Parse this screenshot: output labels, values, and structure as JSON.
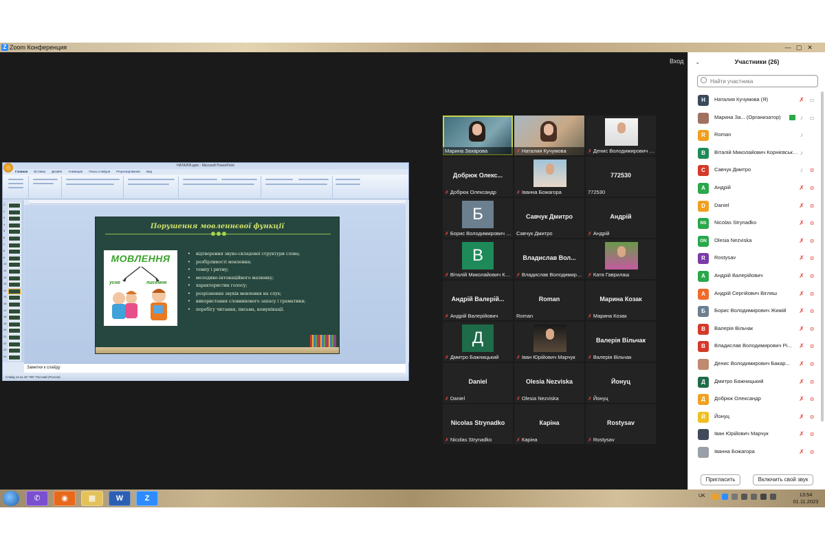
{
  "window": {
    "title": "Zoom Конференция",
    "controls": [
      "—",
      "▢",
      "✕"
    ]
  },
  "meeting": {
    "view_label": "Вход"
  },
  "ppt": {
    "title": "НАТАЛІЯ.pptx - Microsoft PowerPoint",
    "tabs": [
      "Главная",
      "Вставка",
      "Дизайн",
      "Анимация",
      "Показ слайдов",
      "Рецензирование",
      "Вид"
    ],
    "notes_placeholder": "Заметки к слайду",
    "status": "Слайд 14 из 40    \"ОЕ\"    Русский (Россия)",
    "thumb_numbers": [
      "1",
      "2",
      "3",
      "4",
      "5",
      "6",
      "7",
      "8",
      "9",
      "10",
      "11",
      "12",
      "13",
      "14",
      "15",
      "16",
      "17",
      "18",
      "19",
      "20",
      "21",
      "22",
      "23",
      "24"
    ]
  },
  "slide": {
    "title": "Порушення мовленнєвої функції",
    "image_word": "МОВЛЕННЯ",
    "image_left": "усне",
    "image_right": "писемне",
    "bullets": [
      "відтворення звуко-складової структури слова;",
      "розбірливості мовлення;",
      "темпу і ритму;",
      "мелодико-інтонаційного малюнку;",
      " характеристик голосу;",
      "розрізнення звуків мовлення на слух;",
      "використання словникового запасу і граматики;",
      "перебігу читання, письма, комунікації."
    ]
  },
  "grid": {
    "tiles": [
      {
        "name": "",
        "label": "Марина Захарова",
        "muted": false,
        "kind": "video",
        "active": true
      },
      {
        "name": "",
        "label": "Наталия Кучумова",
        "muted": true,
        "kind": "video"
      },
      {
        "name": "",
        "label": "Денис Володимирович Бакар...",
        "muted": true,
        "kind": "photo"
      },
      {
        "name": "Добрюк Олекс...",
        "label": "Добрюк Олександр",
        "muted": true,
        "kind": "name"
      },
      {
        "name": "",
        "label": "Іванна Божагора",
        "muted": true,
        "kind": "photo"
      },
      {
        "name": "772530",
        "label": "772530",
        "muted": false,
        "kind": "name"
      },
      {
        "name": "Б",
        "label": "Борис Володимирович Жижій",
        "muted": true,
        "kind": "letter",
        "color": "#6b7f8f"
      },
      {
        "name": "Савчук Дмитро",
        "label": "Савчук Дмитро",
        "muted": false,
        "kind": "name"
      },
      {
        "name": "Андрій",
        "label": "Андрій",
        "muted": true,
        "kind": "name"
      },
      {
        "name": "В",
        "label": "Віталій Миколайович Корнієвський",
        "muted": true,
        "kind": "letter",
        "color": "#1e8a5a"
      },
      {
        "name": "Владислав Вол...",
        "label": "Владислав Володимирович Рі...",
        "muted": true,
        "kind": "name"
      },
      {
        "name": "",
        "label": "Катя Гаврилаш",
        "muted": true,
        "kind": "photo"
      },
      {
        "name": "Андрій Валерій...",
        "label": "Андрій Валерійович",
        "muted": true,
        "kind": "name"
      },
      {
        "name": "Roman",
        "label": "Roman",
        "muted": false,
        "kind": "name"
      },
      {
        "name": "Марина Козак",
        "label": "Марина Козак",
        "muted": true,
        "kind": "name"
      },
      {
        "name": "Д",
        "label": "Дмитро Бажницький",
        "muted": true,
        "kind": "letter",
        "color": "#1e6b4a"
      },
      {
        "name": "",
        "label": "Іван Юрійович Марчук",
        "muted": true,
        "kind": "photo"
      },
      {
        "name": "Валерія Вільчак",
        "label": "Валерія Вільчак",
        "muted": true,
        "kind": "name"
      },
      {
        "name": "Daniel",
        "label": "Daniel",
        "muted": true,
        "kind": "name"
      },
      {
        "name": "Olesia Nezviska",
        "label": "Olesia Nezviska",
        "muted": true,
        "kind": "name"
      },
      {
        "name": "Йонуц",
        "label": "Йонуц",
        "muted": true,
        "kind": "name"
      },
      {
        "name": "Nicolas Strynadko",
        "label": "Nicolas Strynadko",
        "muted": true,
        "kind": "name"
      },
      {
        "name": "Каріна",
        "label": "Каріна",
        "muted": true,
        "kind": "name"
      },
      {
        "name": "Rostysav",
        "label": "Rostysav",
        "muted": true,
        "kind": "name"
      }
    ]
  },
  "panel": {
    "title": "Участники (26)",
    "search_placeholder": "Найти участника",
    "invite_label": "Пригласить",
    "unmute_label": "Включить свой звук",
    "participants": [
      {
        "initial": "Н",
        "name": "Наталия Кучумова (Я)",
        "color": "#3b4a5a",
        "mic": "muted",
        "cam": "off-gray"
      },
      {
        "initial": "",
        "name": "Марина За... (Организатор)",
        "color": "#a07060",
        "mic": "on",
        "cam": "on"
      },
      {
        "initial": "R",
        "name": "Roman",
        "color": "#f0a020",
        "mic": "on",
        "cam": "none"
      },
      {
        "initial": "В",
        "name": "Віталій Миколайович Корнієвський",
        "color": "#1e8a5a",
        "mic": "on",
        "cam": "none"
      },
      {
        "initial": "С",
        "name": "Савчук Дмитро",
        "color": "#d43a2a",
        "mic": "on",
        "cam": "muted"
      },
      {
        "initial": "А",
        "name": "Андрій",
        "color": "#2aa84a",
        "mic": "muted",
        "cam": "muted"
      },
      {
        "initial": "D",
        "name": "Daniel",
        "color": "#f0a020",
        "mic": "muted",
        "cam": "muted"
      },
      {
        "initial": "NS",
        "name": "Nicolas Strynadko",
        "color": "#2aa84a",
        "mic": "muted",
        "cam": "muted"
      },
      {
        "initial": "ON",
        "name": "Olesia Nezviska",
        "color": "#2aa84a",
        "mic": "muted",
        "cam": "muted"
      },
      {
        "initial": "R",
        "name": "Rostysav",
        "color": "#7a3aa8",
        "mic": "muted",
        "cam": "muted"
      },
      {
        "initial": "А",
        "name": "Андрій Валерійович",
        "color": "#2aa84a",
        "mic": "muted",
        "cam": "muted"
      },
      {
        "initial": "А",
        "name": "Андрій Сергійович Вігляш",
        "color": "#f06a2a",
        "mic": "muted",
        "cam": "muted"
      },
      {
        "initial": "Б",
        "name": "Борис Володимирович Жижій",
        "color": "#6b7f8f",
        "mic": "muted",
        "cam": "muted"
      },
      {
        "initial": "В",
        "name": "Валерія Вільчак",
        "color": "#d43a2a",
        "mic": "muted",
        "cam": "muted"
      },
      {
        "initial": "В",
        "name": "Владислав Володимирович Рі...",
        "color": "#d43a2a",
        "mic": "muted",
        "cam": "muted"
      },
      {
        "initial": "",
        "name": "Денис Володимирович Бакар...",
        "color": "#c08a70",
        "mic": "muted",
        "cam": "muted"
      },
      {
        "initial": "Д",
        "name": "Дмитро Бажницький",
        "color": "#1e6b4a",
        "mic": "muted",
        "cam": "muted"
      },
      {
        "initial": "Д",
        "name": "Добрюк Олександр",
        "color": "#f0a020",
        "mic": "muted",
        "cam": "muted"
      },
      {
        "initial": "Й",
        "name": "Йонуц",
        "color": "#f0c020",
        "mic": "muted",
        "cam": "muted"
      },
      {
        "initial": "",
        "name": "Іван Юрійович Марчук",
        "color": "#404a5a",
        "mic": "muted",
        "cam": "muted"
      },
      {
        "initial": "",
        "name": "Іванна Божагора",
        "color": "#9aa0a8",
        "mic": "muted",
        "cam": "muted"
      }
    ]
  },
  "taskbar": {
    "apps": [
      {
        "name": "viber",
        "glyph": "✆",
        "color": "#7a4fd0"
      },
      {
        "name": "firefox",
        "glyph": "◉",
        "color": "#e8681c"
      },
      {
        "name": "explorer",
        "glyph": "▦",
        "color": "#e4c25a"
      },
      {
        "name": "word",
        "glyph": "W",
        "color": "#2b5fb3"
      },
      {
        "name": "zoom",
        "glyph": "Z",
        "color": "#2d8cff"
      }
    ],
    "language": "UK",
    "time": "13:54",
    "date": "01.11.2023"
  }
}
